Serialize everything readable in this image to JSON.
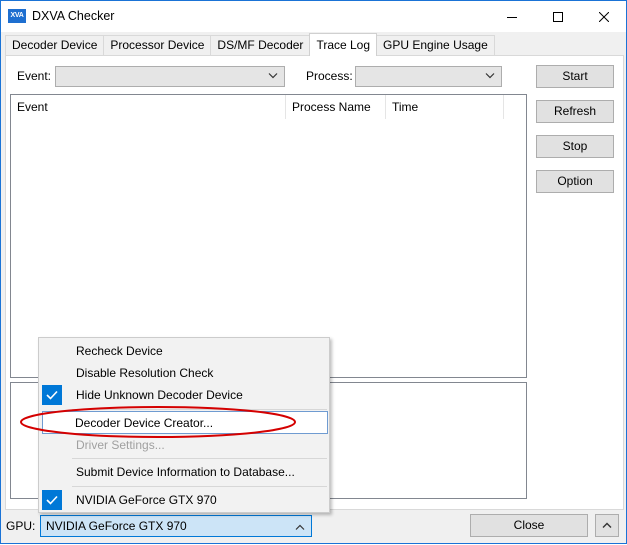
{
  "window": {
    "title": "DXVA Checker",
    "icon_text": "XVA"
  },
  "tabs": [
    {
      "label": "Decoder Device"
    },
    {
      "label": "Processor Device"
    },
    {
      "label": "DS/MF Decoder"
    },
    {
      "label": "Trace Log",
      "active": true
    },
    {
      "label": "GPU Engine Usage"
    }
  ],
  "filters": {
    "event_label": "Event:",
    "event_value": "",
    "process_label": "Process:",
    "process_value": ""
  },
  "table": {
    "columns": [
      "Event",
      "Process Name",
      "Time"
    ]
  },
  "buttons": {
    "start": "Start",
    "refresh": "Refresh",
    "stop": "Stop",
    "option": "Option",
    "close": "Close"
  },
  "gpu": {
    "label": "GPU:",
    "value": "NVIDIA GeForce GTX 970"
  },
  "context_menu": {
    "items": [
      {
        "label": "Recheck Device",
        "checked": false
      },
      {
        "label": "Disable Resolution Check",
        "checked": false
      },
      {
        "label": "Hide Unknown Decoder Device",
        "checked": true
      },
      {
        "label": "Decoder Device Creator...",
        "checked": false,
        "highlighted": true
      },
      {
        "label": "Driver Settings...",
        "checked": false,
        "disabled": true
      },
      {
        "label": "Submit Device Information to Database...",
        "checked": false
      },
      {
        "label": "NVIDIA GeForce GTX 970",
        "checked": true
      }
    ]
  },
  "colors": {
    "accent": "#0078d7",
    "annotation": "#d40000"
  }
}
